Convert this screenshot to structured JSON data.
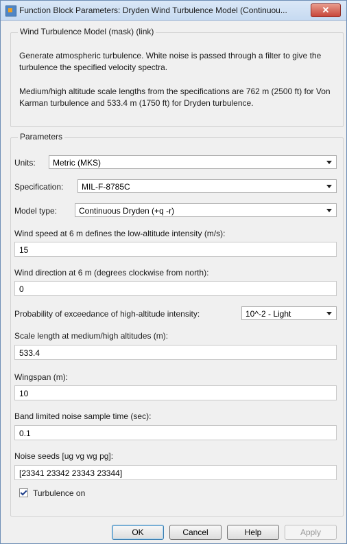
{
  "window": {
    "title": "Function Block Parameters: Dryden Wind Turbulence Model (Continuou...",
    "close_label": "✕"
  },
  "mask": {
    "title": "Wind Turbulence Model (mask) (link)",
    "description_1": "Generate atmospheric turbulence. White noise is passed through a filter to give the turbulence the specified velocity spectra.",
    "description_2": "Medium/high altitude scale lengths from the specifications are 762 m (2500 ft) for Von Karman turbulence and 533.4 m (1750 ft) for Dryden turbulence."
  },
  "parameters": {
    "title": "Parameters",
    "units": {
      "label": "Units:",
      "value": "Metric (MKS)"
    },
    "specification": {
      "label": "Specification:",
      "value": "MIL-F-8785C"
    },
    "model_type": {
      "label": "Model type:",
      "value": "Continuous Dryden (+q -r)"
    },
    "wind_speed": {
      "label": "Wind speed at 6 m defines the low-altitude intensity (m/s):",
      "value": "15"
    },
    "wind_direction": {
      "label": "Wind direction at 6 m (degrees clockwise from north):",
      "value": "0"
    },
    "probability": {
      "label": "Probability of exceedance of high-altitude intensity:",
      "value": "10^-2 - Light"
    },
    "scale_length": {
      "label": "Scale length at medium/high altitudes (m):",
      "value": "533.4"
    },
    "wingspan": {
      "label": "Wingspan (m):",
      "value": "10"
    },
    "sample_time": {
      "label": "Band limited noise sample time (sec):",
      "value": "0.1"
    },
    "noise_seeds": {
      "label": "Noise seeds [ug vg wg pg]:",
      "value": "[23341 23342 23343 23344]"
    },
    "turbulence_on": {
      "label": "Turbulence on",
      "checked": true
    }
  },
  "buttons": {
    "ok": "OK",
    "cancel": "Cancel",
    "help": "Help",
    "apply": "Apply"
  }
}
